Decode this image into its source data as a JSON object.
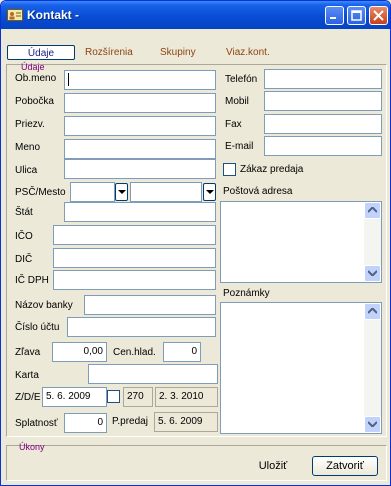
{
  "window": {
    "title": "Kontakt -"
  },
  "tabs": [
    "Údaje",
    "Rozšírenia",
    "Skupiny",
    "Viaz.kont."
  ],
  "groups": {
    "main": "Údaje",
    "actions": "Úkony"
  },
  "left": {
    "ob_meno": {
      "label": "Ob.meno",
      "value": ""
    },
    "pobocka": {
      "label": "Pobočka",
      "value": ""
    },
    "priezv": {
      "label": "Priezv.",
      "value": ""
    },
    "meno": {
      "label": "Meno",
      "value": ""
    },
    "ulica": {
      "label": "Ulica",
      "value": ""
    },
    "psc_mesto": {
      "label": "PSČ/Mesto",
      "psc": "",
      "mesto": ""
    },
    "stat": {
      "label": "Štát",
      "value": ""
    },
    "ico": {
      "label": "IČO",
      "value": ""
    },
    "dic": {
      "label": "DIČ",
      "value": ""
    },
    "ic_dph": {
      "label": "IČ DPH",
      "value": ""
    },
    "nazov_banky": {
      "label": "Názov banky",
      "value": ""
    },
    "cislo_uctu": {
      "label": "Číslo účtu",
      "value": ""
    },
    "zlava": {
      "label": "Zľava",
      "value": "0,00"
    },
    "cen_hlad": {
      "label": "Cen.hlad.",
      "value": "0"
    },
    "karta": {
      "label": "Karta",
      "value": ""
    },
    "zde": {
      "label": "Z/D/E",
      "date": "5. 6. 2009",
      "num": "270",
      "date2": "2. 3. 2010"
    },
    "splatnost": {
      "label": "Splatnosť",
      "value": "0"
    },
    "p_predaj": {
      "label": "P.predaj",
      "value": "5. 6. 2009"
    }
  },
  "right": {
    "telefon": {
      "label": "Telefón",
      "value": ""
    },
    "mobil": {
      "label": "Mobil",
      "value": ""
    },
    "fax": {
      "label": "Fax",
      "value": ""
    },
    "email": {
      "label": "E-mail",
      "value": ""
    },
    "zakaz_predaja": {
      "label": "Zákaz predaja",
      "checked": false
    },
    "postova_adresa": {
      "label": "Poštová adresa",
      "value": ""
    },
    "poznamky": {
      "label": "Poznámky",
      "value": ""
    }
  },
  "buttons": {
    "save": "Uložiť",
    "close": "Zatvoriť"
  }
}
